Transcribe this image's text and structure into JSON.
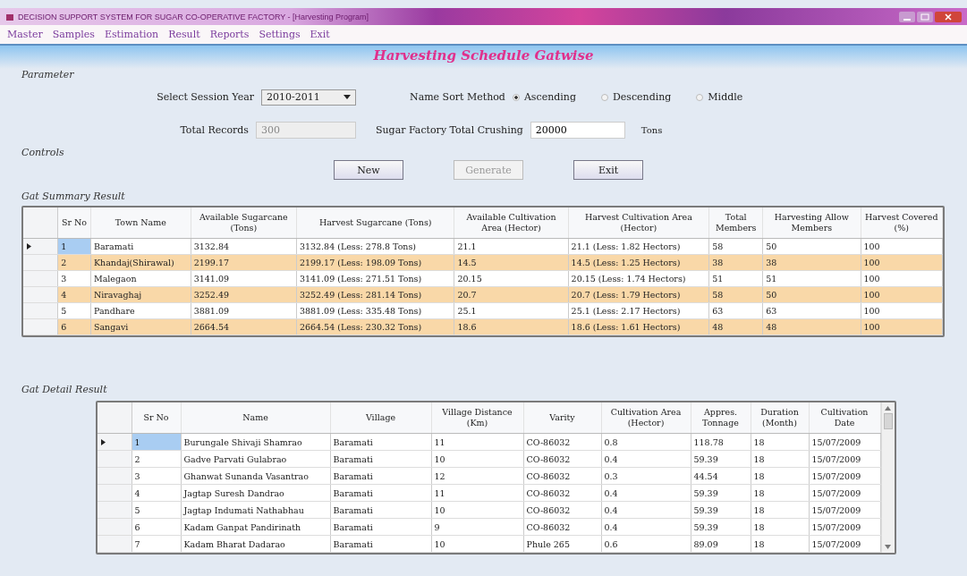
{
  "window": {
    "title": "DECISION SUPPORT SYSTEM FOR SUGAR CO-OPERATIVE FACTORY - [Harvesting Program]"
  },
  "menu": [
    "Master",
    "Samples",
    "Estimation",
    "Result",
    "Reports",
    "Settings",
    "Exit"
  ],
  "page_title": "Harvesting Schedule Gatwise",
  "parameter": {
    "heading": "Parameter",
    "session_year": {
      "label": "Select Session Year",
      "value": "2010-2011"
    },
    "sort": {
      "label": "Name Sort Method",
      "options": [
        {
          "label": "Ascending",
          "selected": true
        },
        {
          "label": "Descending",
          "selected": false
        },
        {
          "label": "Middle",
          "selected": false
        }
      ]
    },
    "total_records": {
      "label": "Total Records",
      "value": "300",
      "disabled": true
    },
    "crushing": {
      "label": "Sugar Factory Total Crushing",
      "value": "20000",
      "unit": "Tons"
    }
  },
  "controls": {
    "heading": "Controls",
    "buttons": [
      {
        "label": "New",
        "disabled": false
      },
      {
        "label": "Generate",
        "disabled": true
      },
      {
        "label": "Exit",
        "disabled": false
      }
    ]
  },
  "summary": {
    "heading": "Gat Summary Result",
    "columns": [
      "Sr No",
      "Town Name",
      "Available Sugarcane (Tons)",
      "Harvest Sugarcane (Tons)",
      "Available Cultivation Area (Hector)",
      "Harvest Cultivation Area (Hector)",
      "Total Members",
      "Harvesting Allow Members",
      "Harvest Covered (%)"
    ],
    "rows": [
      {
        "selected": true,
        "cells": [
          "1",
          "Baramati",
          "3132.84",
          "3132.84  (Less:  278.8 Tons)",
          "21.1",
          "21.1  (Less:  1.82 Hectors)",
          "58",
          "50",
          "100"
        ]
      },
      {
        "selected": false,
        "cells": [
          "2",
          "Khandaj(Shirawal)",
          "2199.17",
          "2199.17  (Less:  198.09 Tons)",
          "14.5",
          "14.5  (Less:  1.25 Hectors)",
          "38",
          "38",
          "100"
        ]
      },
      {
        "selected": false,
        "cells": [
          "3",
          "Malegaon",
          "3141.09",
          "3141.09  (Less:  271.51 Tons)",
          "20.15",
          "20.15  (Less:  1.74 Hectors)",
          "51",
          "51",
          "100"
        ]
      },
      {
        "selected": false,
        "cells": [
          "4",
          "Niravaghaj",
          "3252.49",
          "3252.49  (Less:  281.14 Tons)",
          "20.7",
          "20.7  (Less:  1.79 Hectors)",
          "58",
          "50",
          "100"
        ]
      },
      {
        "selected": false,
        "cells": [
          "5",
          "Pandhare",
          "3881.09",
          "3881.09  (Less:  335.48 Tons)",
          "25.1",
          "25.1  (Less:  2.17 Hectors)",
          "63",
          "63",
          "100"
        ]
      },
      {
        "selected": false,
        "cells": [
          "6",
          "Sangavi",
          "2664.54",
          "2664.54  (Less:  230.32 Tons)",
          "18.6",
          "18.6  (Less:  1.61 Hectors)",
          "48",
          "48",
          "100"
        ]
      }
    ]
  },
  "detail": {
    "heading": "Gat Detail Result",
    "columns": [
      "Sr No",
      "Name",
      "Village",
      "Village Distance (Km)",
      "Varity",
      "Cultivation Area (Hector)",
      "Appres. Tonnage",
      "Duration (Month)",
      "Cultivation Date"
    ],
    "rows": [
      {
        "selected": true,
        "cells": [
          "1",
          "Burungale Shivaji Shamrao",
          "Baramati",
          "11",
          "CO-86032",
          "0.8",
          "118.78",
          "18",
          "15/07/2009"
        ]
      },
      {
        "selected": false,
        "cells": [
          "2",
          "Gadve Parvati Gulabrao",
          "Baramati",
          "10",
          "CO-86032",
          "0.4",
          "59.39",
          "18",
          "15/07/2009"
        ]
      },
      {
        "selected": false,
        "cells": [
          "3",
          "Ghanwat Sunanda Vasantrao",
          "Baramati",
          "12",
          "CO-86032",
          "0.3",
          "44.54",
          "18",
          "15/07/2009"
        ]
      },
      {
        "selected": false,
        "cells": [
          "4",
          "Jagtap Suresh Dandrao",
          "Baramati",
          "11",
          "CO-86032",
          "0.4",
          "59.39",
          "18",
          "15/07/2009"
        ]
      },
      {
        "selected": false,
        "cells": [
          "5",
          "Jagtap Indumati Nathabhau",
          "Baramati",
          "10",
          "CO-86032",
          "0.4",
          "59.39",
          "18",
          "15/07/2009"
        ]
      },
      {
        "selected": false,
        "cells": [
          "6",
          "Kadam Ganpat Pandirinath",
          "Baramati",
          "9",
          "CO-86032",
          "0.4",
          "59.39",
          "18",
          "15/07/2009"
        ]
      },
      {
        "selected": false,
        "cells": [
          "7",
          "Kadam Bharat Dadarao",
          "Baramati",
          "10",
          "Phule 265",
          "0.6",
          "89.09",
          "18",
          "15/07/2009"
        ]
      }
    ]
  }
}
